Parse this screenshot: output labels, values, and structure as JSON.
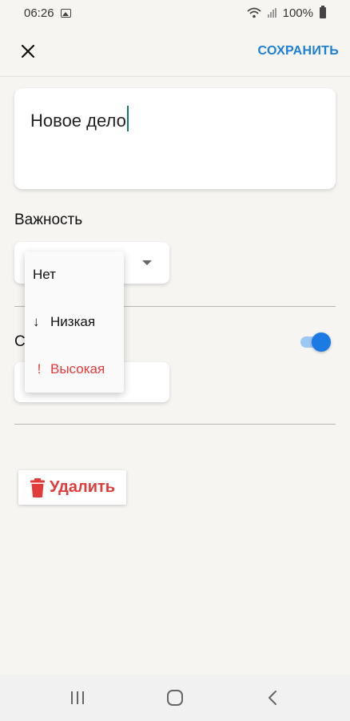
{
  "status_bar": {
    "time": "06:26",
    "battery": "100%",
    "icons": [
      "image-icon",
      "wifi-icon",
      "signal-icon",
      "battery-icon"
    ]
  },
  "app_bar": {
    "close_icon": "close-icon",
    "save_label": "СОХРАНИТЬ"
  },
  "task": {
    "text": "Новое дело"
  },
  "importance": {
    "label": "Важность",
    "menu_items": [
      {
        "glyph": "",
        "label": "Нет"
      },
      {
        "glyph": "↓",
        "label": "Низкая"
      },
      {
        "glyph": "!",
        "label": "Высокая"
      }
    ]
  },
  "deadline": {
    "label_visible": "С",
    "toggle_on": true
  },
  "delete": {
    "icon": "trash-icon",
    "label": "Удалить"
  },
  "nav_bar": {
    "buttons": [
      "recents-icon",
      "home-icon",
      "back-icon"
    ]
  },
  "colors": {
    "accent": "#1e7fd6",
    "danger": "#e23b3b",
    "toggle_thumb": "#1b7ae3",
    "cursor": "#0a7a70",
    "background": "#f6f5f2"
  }
}
